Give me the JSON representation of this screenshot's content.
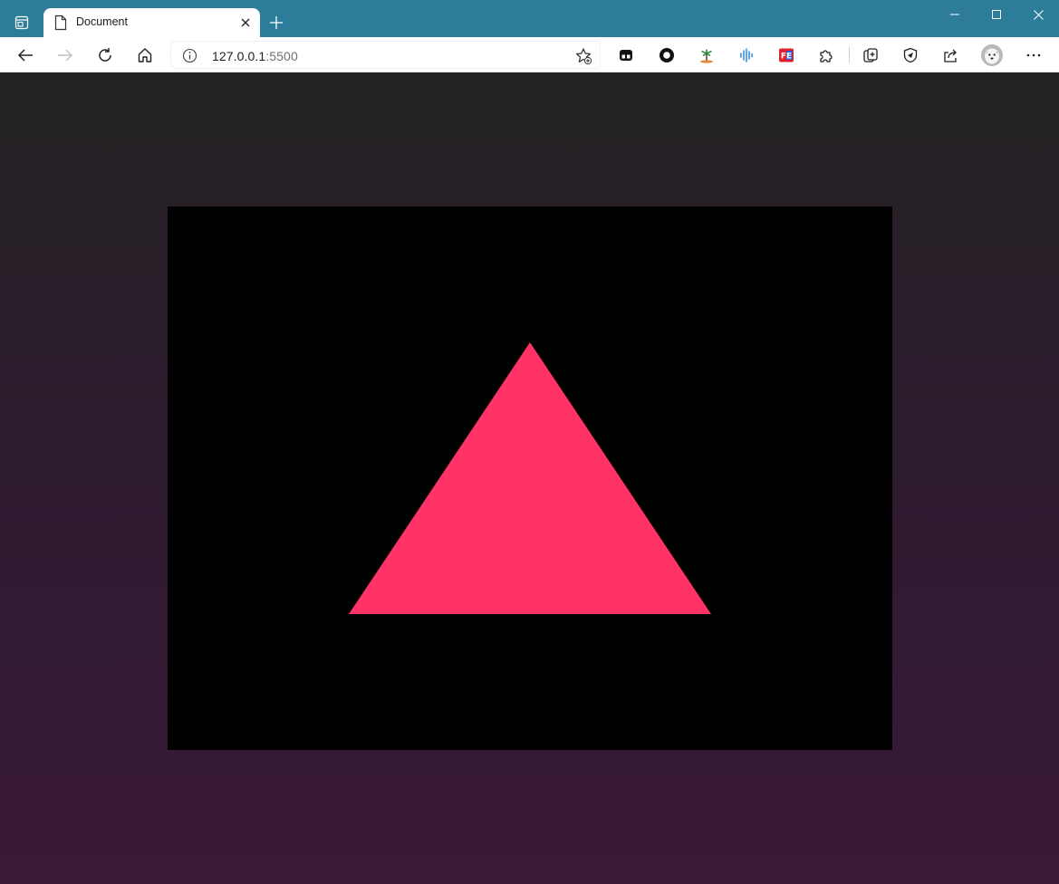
{
  "window": {
    "tab_title": "Document",
    "new_tab_icon": "plus-icon",
    "controls": [
      "minimize-icon",
      "maximize-icon",
      "close-icon"
    ]
  },
  "toolbar": {
    "url_host": "127.0.0.1",
    "url_port": ":5500",
    "buttons": [
      "back-icon",
      "forward-icon",
      "refresh-icon",
      "home-icon"
    ],
    "extensions": [
      "extension-tab-manager-icon",
      "extension-circle-icon",
      "extension-island-icon",
      "extension-audio-icon",
      "extension-fe-icon",
      "extensions-puzzle-icon",
      "collections-icon",
      "browser-essentials-icon",
      "share-icon",
      "profile-avatar",
      "more-menu-icon"
    ],
    "fe_badge_text": "FE"
  },
  "page": {
    "background_top": "#222222",
    "background_bottom": "#3a1838",
    "canvas_color": "#000000",
    "triangle_color": "#ff3366"
  }
}
